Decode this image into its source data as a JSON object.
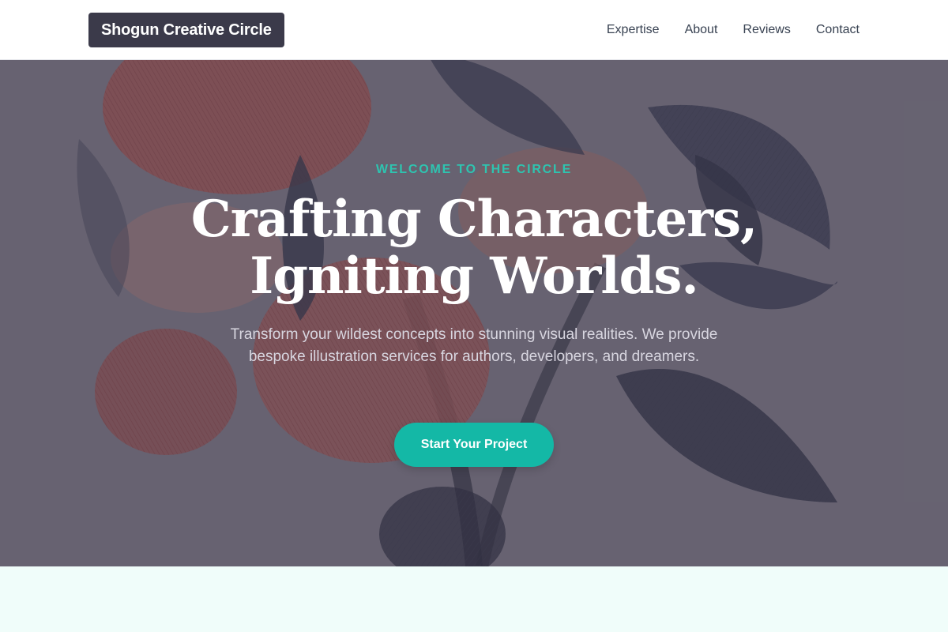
{
  "header": {
    "brand": "Shogun Creative Circle",
    "nav": [
      {
        "label": "Expertise"
      },
      {
        "label": "About"
      },
      {
        "label": "Reviews"
      },
      {
        "label": "Contact"
      }
    ]
  },
  "hero": {
    "eyebrow": "WELCOME TO THE CIRCLE",
    "headline_line1": "Crafting Characters,",
    "headline_line2": "Igniting Worlds.",
    "subtext": "Transform your wildest concepts into stunning visual realities. We provide bespoke illustration services for authors, developers, and dreamers.",
    "cta_label": "Start Your Project",
    "background_image": "botanical-floral-engraving"
  },
  "colors": {
    "accent": "#14b8a6",
    "eyebrow": "#2ec4b0",
    "brand_bg": "#3b3a4a",
    "section_bg": "#f0fdfa"
  }
}
